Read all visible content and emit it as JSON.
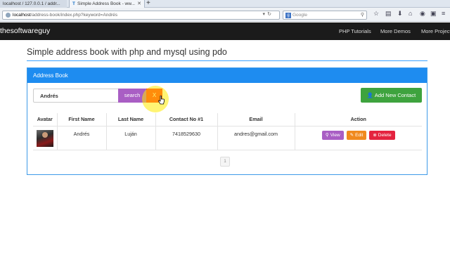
{
  "browser": {
    "tabs": [
      {
        "label": "localhost / 127.0.0.1 / addr..."
      },
      {
        "label": "Simple Address Book - ww..."
      }
    ],
    "url_host": "localhost",
    "url_rest": "/address-book/index.php?keyword=Andrés",
    "search_engine": "Google",
    "search_placeholder": "Google"
  },
  "site": {
    "brand": "thesoftwareguy",
    "nav": [
      "PHP Tutorials",
      "More Demos",
      "More Projects"
    ]
  },
  "page": {
    "title": "Simple address book with php and mysql using pdo"
  },
  "panel": {
    "heading": "Address Book",
    "search_value": "Andrés",
    "search_label": "search",
    "clear_label": "X",
    "add_label": "Add New Contact"
  },
  "table": {
    "columns": [
      "Avatar",
      "First Name",
      "Last Name",
      "Contact No #1",
      "Email",
      "Action"
    ],
    "rows": [
      {
        "first": "Andrés",
        "last": "Luján",
        "phone": "7418529630",
        "email": "andres@gmail.com"
      }
    ],
    "actions": {
      "view": "View",
      "edit": "Edit",
      "delete": "Delete"
    }
  },
  "pagination": {
    "current": "1"
  },
  "colors": {
    "panel_blue": "#1e8cf0",
    "search_purple": "#a95ec4",
    "clear_red": "#ff1a1a",
    "add_green": "#3ea33e",
    "edit_orange": "#f08a1e",
    "delete_red": "#e4233f"
  }
}
